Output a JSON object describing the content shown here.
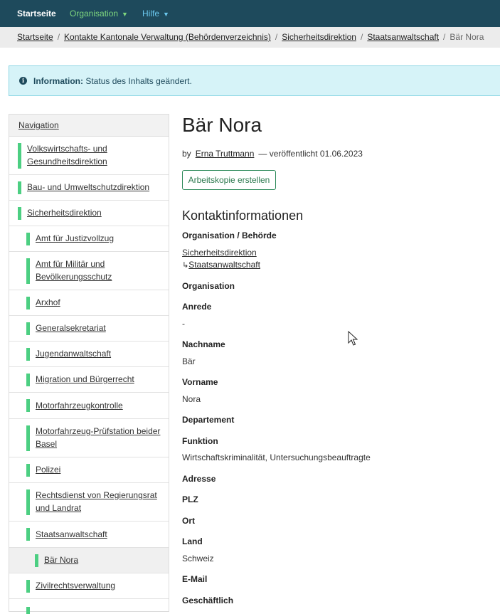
{
  "topbar": {
    "home": "Startseite",
    "organisation": "Organisation",
    "help": "Hilfe",
    "caret": "▼"
  },
  "breadcrumb": {
    "items": [
      "Startseite",
      "Kontakte Kantonale Verwaltung (Behördenverzeichnis)",
      "Sicherheitsdirektion",
      "Staatsanwaltschaft"
    ],
    "current": "Bär Nora",
    "separator": "/"
  },
  "info": {
    "icon": "info-icon",
    "label": "Information:",
    "message": "Status des Inhalts geändert."
  },
  "nav": {
    "header": "Navigation",
    "items": [
      {
        "label_1": "Volkswirtschafts- und",
        "label_2": "Gesundheitsdirektion"
      },
      {
        "label_1": "Bau- und Umweltschutzdirektion"
      },
      {
        "label_1": "Sicherheitsdirektion"
      },
      {
        "label_1": "Amt für Justizvollzug"
      },
      {
        "label_1": "Amt für Militär und",
        "label_2": "Bevölkerungsschutz"
      },
      {
        "label_1": "Arxhof"
      },
      {
        "label_1": "Generalsekretariat"
      },
      {
        "label_1": "Jugendanwaltschaft"
      },
      {
        "label_1": "Migration und Bürgerrecht"
      },
      {
        "label_1": "Motorfahrzeugkontrolle"
      },
      {
        "label_1": "Motorfahrzeug-Prüfstation beider",
        "label_2": "Basel"
      },
      {
        "label_1": "Polizei"
      },
      {
        "label_1": "Rechtsdienst von Regierungsrat",
        "label_2": "und Landrat"
      },
      {
        "label_1": "Staatsanwaltschaft"
      },
      {
        "label_1": "Bär Nora"
      },
      {
        "label_1": "Zivilrechtsverwaltung"
      }
    ],
    "accent": "#4ccf82"
  },
  "page": {
    "title": "Bär Nora",
    "by": "by",
    "author": "Erna Truttmann",
    "published": "— veröffentlicht 01.06.2023",
    "action_button": "Arbeitskopie erstellen"
  },
  "contact": {
    "heading": "Kontaktinformationen",
    "org_label": "Organisation / Behörde",
    "org_parent": "Sicherheitsdirektion",
    "org_child_arrow": "↳",
    "org_child": "Staatsanwaltschaft",
    "organisation_label": "Organisation",
    "anrede_label": "Anrede",
    "anrede_value": "-",
    "nachname_label": "Nachname",
    "nachname_value": "Bär",
    "vorname_label": "Vorname",
    "vorname_value": "Nora",
    "departement_label": "Departement",
    "funktion_label": "Funktion",
    "funktion_value": "Wirtschaftskriminalität, Untersuchungsbeauftragte",
    "adresse_label": "Adresse",
    "plz_label": "PLZ",
    "ort_label": "Ort",
    "land_label": "Land",
    "land_value": "Schweiz",
    "email_label": "E-Mail",
    "geschaeftlich_label": "Geschäftlich"
  },
  "colors": {
    "topbar_bg": "#1e4a5c",
    "info_bg": "#d6f3f8",
    "button_border": "#2d8a5a"
  }
}
